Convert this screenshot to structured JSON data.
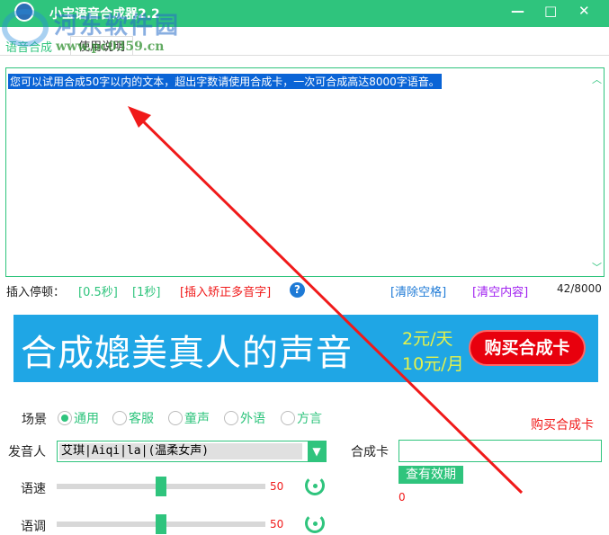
{
  "window": {
    "title": "小宝语音合成器2.2",
    "minimize": "—",
    "maximize": "□",
    "close": "✕"
  },
  "watermark": {
    "text": "河东软件园",
    "url": "www.pc0359.cn"
  },
  "tabs": [
    {
      "label": "语音合成"
    },
    {
      "label": "使用说明"
    }
  ],
  "editor": {
    "text": "您可以试用合成50字以内的文本，超出字数请使用合成卡，一次可合成高达8000字语音。"
  },
  "toolbar": {
    "insert_pause": "插入停顿：",
    "pause_05": "[0.5秒]",
    "pause_1": "[1秒]",
    "polyphone": "[插入矫正多音字]",
    "help": "?",
    "clear_spaces": "[清除空格]",
    "clear_content": "[清空内容]",
    "count": "42/8000"
  },
  "banner": {
    "headline": "合成媲美真人的声音",
    "price_day": "2元/天",
    "price_month": "10元/月",
    "buy": "购买合成卡"
  },
  "scene": {
    "label": "场景",
    "options": [
      "通用",
      "客服",
      "童声",
      "外语",
      "方言"
    ],
    "selected": "通用"
  },
  "speaker": {
    "label": "发音人",
    "value": "艾琪|Aiqi|la|(温柔女声)"
  },
  "card": {
    "buy_link": "购买合成卡",
    "label": "合成卡",
    "value": "",
    "check": "查有效期",
    "balance": "0"
  },
  "speed": {
    "label": "语速",
    "value": 50
  },
  "pitch": {
    "label": "语调",
    "value": 50
  },
  "colors": {
    "accent": "#2fc47d",
    "banner": "#1fa6e5",
    "arrow": "#f01a1a"
  }
}
